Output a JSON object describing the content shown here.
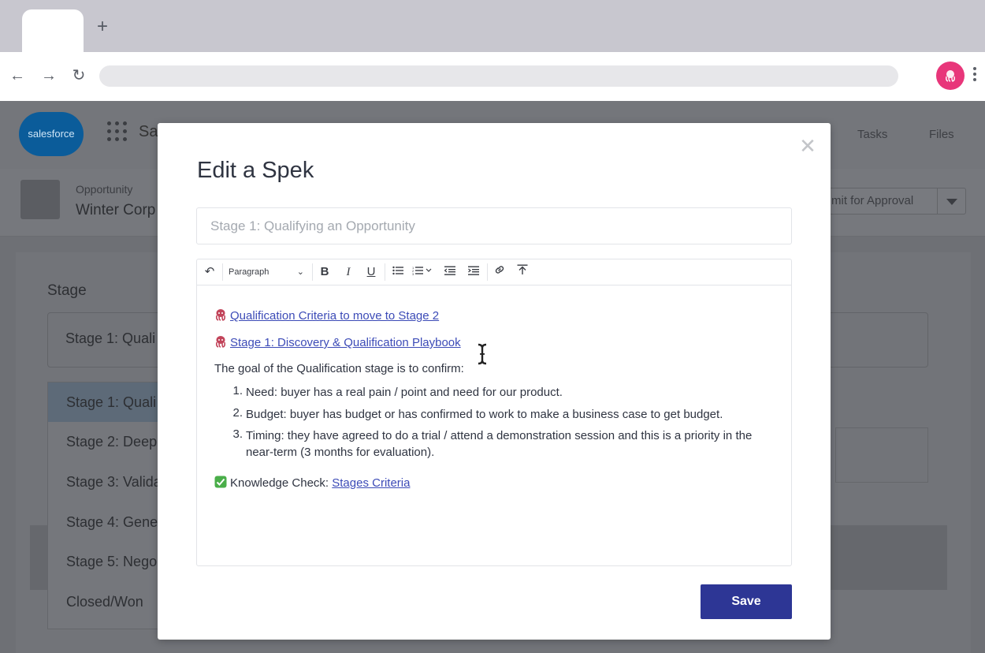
{
  "browser": {
    "new_tab_icon": "plus-icon",
    "back_icon": "arrow-left-icon",
    "forward_icon": "arrow-right-icon",
    "reload_icon": "reload-icon",
    "profile_color": "#e8367a"
  },
  "background": {
    "logo_text": "salesforce",
    "app_name": "Sa",
    "nav": [
      "Tasks",
      "Files"
    ],
    "record_type": "Opportunity",
    "record_name": "Winter Corp",
    "approval_button": "mit for Approval",
    "stage_section_title": "Stage",
    "stage_selected": "Stage 1: Quali",
    "stage_list": [
      "Stage 1: Quali",
      "Stage 2: Deep",
      "Stage 3: Valida",
      "Stage 4: Gene",
      "Stage 5: Nego",
      "Closed/Won"
    ]
  },
  "modal": {
    "title": "Edit a Spek",
    "close_icon": "close-icon",
    "title_input_placeholder": "Stage 1: Qualifying an Opportunity",
    "toolbar": {
      "paragraph_label": "Paragraph",
      "buttons": [
        "undo-icon",
        "bold-icon",
        "italic-icon",
        "underline-icon",
        "bullet-list-icon",
        "numbered-list-icon",
        "outdent-icon",
        "indent-icon",
        "link-icon",
        "upload-icon"
      ]
    },
    "content": {
      "link1": "Qualification Criteria to move to Stage 2",
      "link2": "Stage 1: Discovery & Qualification Playbook",
      "intro": "The goal of the Qualification stage is to confirm:",
      "items": [
        {
          "num": "1.",
          "text": "Need: buyer has a real pain / point and need for our product."
        },
        {
          "num": "2.",
          "text": "Budget: buyer has budget or has confirmed to work to make a business case to get budget."
        },
        {
          "num": "3.",
          "text": "Timing: they have agreed to do a trial / attend a demonstration session and this is a priority in the near-term (3 months for evaluation)."
        }
      ],
      "knowledge_prefix": "Knowledge Check: ",
      "knowledge_link": "Stages Criteria"
    },
    "save_label": "Save",
    "accent_color": "#2d3695",
    "link_color": "#3c4bb7"
  }
}
